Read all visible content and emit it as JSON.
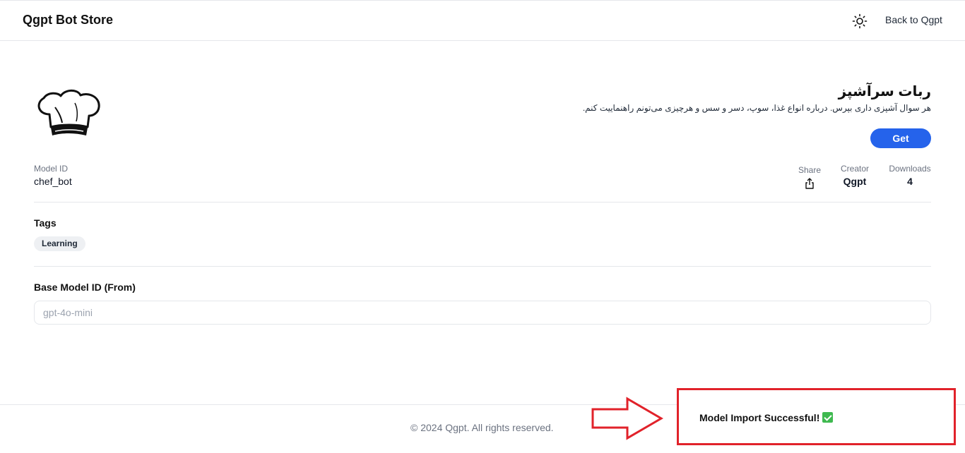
{
  "header": {
    "brand": "Qgpt Bot Store",
    "theme_icon": "sun-icon",
    "back_label": "Back to Qgpt"
  },
  "bot": {
    "name": "ربات سرآشپز",
    "description": "هر سوال آشپزی داری بپرس. درباره انواع غذا، سوپ، دسر و سس و هرچیزی می‌تونم راهنماییت کنم.",
    "logo_icon": "chef-hat-icon",
    "get_label": "Get"
  },
  "meta": {
    "model_id_label": "Model ID",
    "model_id": "chef_bot",
    "share_label": "Share",
    "share_icon": "share-icon",
    "creator_label": "Creator",
    "creator": "Qgpt",
    "downloads_label": "Downloads",
    "downloads": "4"
  },
  "tags": {
    "title": "Tags",
    "items": [
      "Learning"
    ]
  },
  "base_model": {
    "title": "Base Model ID (From)",
    "value": "gpt-4o-mini"
  },
  "footer": {
    "copyright": "© 2024 Qgpt. All rights reserved."
  },
  "toast": {
    "message": "Model Import Successful!",
    "icon": "check-mark-icon",
    "highlight_color": "#e1222a"
  },
  "colors": {
    "accent": "#2563eb"
  }
}
